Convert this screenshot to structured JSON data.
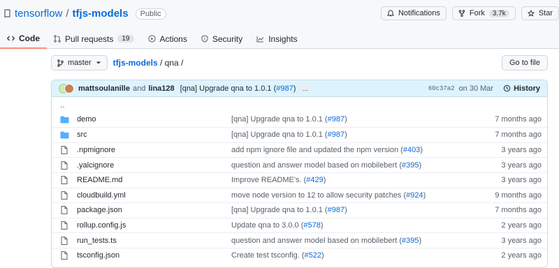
{
  "repo": {
    "owner": "tensorflow",
    "name": "tfjs-models",
    "visibility": "Public"
  },
  "top_actions": {
    "notifications": "Notifications",
    "fork": "Fork",
    "fork_count": "3.7k",
    "star": "Star"
  },
  "tabs": [
    {
      "label": "Code"
    },
    {
      "label": "Pull requests",
      "count": "19"
    },
    {
      "label": "Actions"
    },
    {
      "label": "Security"
    },
    {
      "label": "Insights"
    }
  ],
  "branch": "master",
  "breadcrumb": {
    "repo": "tfjs-models",
    "sep1": "/",
    "dir": "qna",
    "sep2": "/"
  },
  "goto_file": "Go to file",
  "commit": {
    "author1": "mattsoulanille",
    "and": "and",
    "author2": "lina128",
    "message": "[qna] Upgrade qna to 1.0.1 (",
    "pr": "#987",
    "message_end": ")",
    "ellipsis": "…",
    "sha": "60c37a2",
    "date": "on 30 Mar",
    "history": "History"
  },
  "updir": "..",
  "files": [
    {
      "type": "dir",
      "name": "demo",
      "msg": "[qna] Upgrade qna to 1.0.1 (",
      "pr": "#987",
      "msg_end": ")",
      "age": "7 months ago"
    },
    {
      "type": "dir",
      "name": "src",
      "msg": "[qna] Upgrade qna to 1.0.1 (",
      "pr": "#987",
      "msg_end": ")",
      "age": "7 months ago"
    },
    {
      "type": "file",
      "name": ".npmignore",
      "msg": "add npm ignore file and updated the npm version (",
      "pr": "#403",
      "msg_end": ")",
      "age": "3 years ago"
    },
    {
      "type": "file",
      "name": ".yalcignore",
      "msg": "question and answer model based on mobilebert (",
      "pr": "#395",
      "msg_end": ")",
      "age": "3 years ago"
    },
    {
      "type": "file",
      "name": "README.md",
      "msg": "Improve README's. (",
      "pr": "#429",
      "msg_end": ")",
      "age": "3 years ago"
    },
    {
      "type": "file",
      "name": "cloudbuild.yml",
      "msg": "move node version to 12 to allow security patches (",
      "pr": "#924",
      "msg_end": ")",
      "age": "9 months ago"
    },
    {
      "type": "file",
      "name": "package.json",
      "msg": "[qna] Upgrade qna to 1.0.1 (",
      "pr": "#987",
      "msg_end": ")",
      "age": "7 months ago"
    },
    {
      "type": "file",
      "name": "rollup.config.js",
      "msg": "Update qna to 3.0.0 (",
      "pr": "#578",
      "msg_end": ")",
      "age": "2 years ago"
    },
    {
      "type": "file",
      "name": "run_tests.ts",
      "msg": "question and answer model based on mobilebert (",
      "pr": "#395",
      "msg_end": ")",
      "age": "3 years ago"
    },
    {
      "type": "file",
      "name": "tsconfig.json",
      "msg": "Create test tsconfig. (",
      "pr": "#522",
      "msg_end": ")",
      "age": "2 years ago"
    }
  ],
  "colors": {
    "link": "#0969da",
    "folder": "#54aeff",
    "tab_underline": "#fd8c73",
    "commit_bg": "#ddf4ff"
  }
}
